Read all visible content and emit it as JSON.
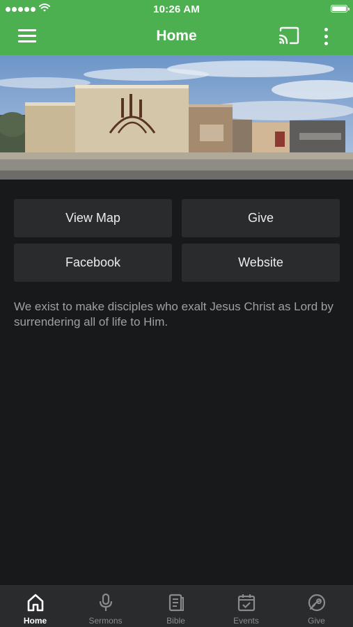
{
  "status_bar": {
    "time": "10:26 AM"
  },
  "header": {
    "title": "Home"
  },
  "buttons": [
    {
      "label": "View Map"
    },
    {
      "label": "Give"
    },
    {
      "label": "Facebook"
    },
    {
      "label": "Website"
    }
  ],
  "description": "We exist to make disciples who exalt Jesus Christ as Lord by surrendering all of life to Him.",
  "tabs": [
    {
      "label": "Home",
      "icon": "home-icon",
      "active": true
    },
    {
      "label": "Sermons",
      "icon": "microphone-icon",
      "active": false
    },
    {
      "label": "Bible",
      "icon": "bible-icon",
      "active": false
    },
    {
      "label": "Events",
      "icon": "calendar-icon",
      "active": false
    },
    {
      "label": "Give",
      "icon": "give-icon",
      "active": false
    }
  ],
  "colors": {
    "header": "#4caf50",
    "background": "#18191b",
    "tile": "#2a2b2d",
    "tab_active": "#ffffff",
    "tab_inactive": "#8a8b8d"
  }
}
